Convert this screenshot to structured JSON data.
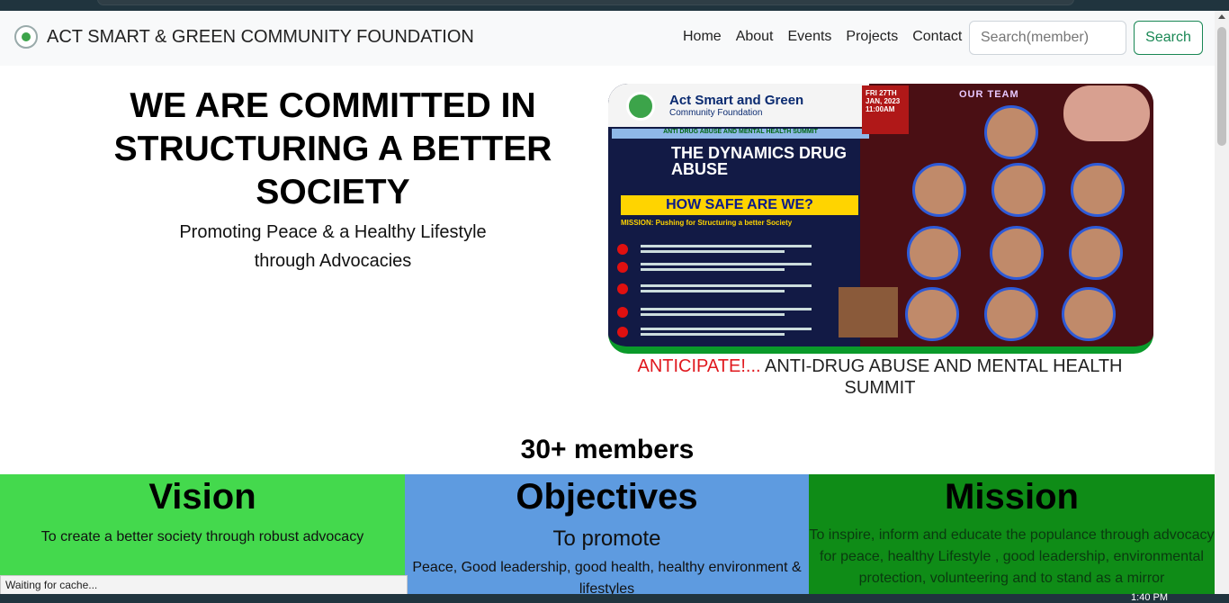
{
  "browser": {
    "status_text": "Waiting for cache...",
    "clock": "1:40 PM"
  },
  "nav": {
    "brand": "ACT SMART & GREEN COMMUNITY FOUNDATION",
    "links": [
      "Home",
      "About",
      "Events",
      "Projects",
      "Contact"
    ],
    "search_placeholder": "Search(member)",
    "search_button": "Search"
  },
  "hero": {
    "title": "WE ARE COMMITTED IN STRUCTURING A BETTER SOCIETY",
    "subtitle_line1": "Promoting Peace & a Healthy Lifestyle",
    "subtitle_line2": "through Advocacies"
  },
  "poster": {
    "org": "Act Smart and Green",
    "org_sub": "Community Foundation",
    "band": "ANTI DRUG ABUSE AND MENTAL HEALTH SUMMIT",
    "theme": "THE DYNAMICS DRUG ABUSE",
    "question": "HOW SAFE ARE WE?",
    "mission": "MISSION: Pushing for Structuring a better Society",
    "team_label": "OUR TEAM",
    "date": "FRI 27TH JAN, 2023 11:00AM"
  },
  "event": {
    "highlight": "ANTICIPATE!...",
    "text": " ANTI-DRUG ABUSE AND MENTAL HEALTH SUMMIT"
  },
  "stats": {
    "members": "30+ members"
  },
  "cards": {
    "vision_title": "Vision",
    "vision_text": "To create a better society through robust advocacy",
    "objectives_title": "Objectives",
    "objectives_lead": "To promote",
    "objectives_text": "Peace, Good leadership, good health, healthy environment & lifestyles",
    "mission_title": "Mission",
    "mission_text": "To inspire, inform and educate the populance through advocacy for peace, healthy Lifestyle , good leadership, environmental protection, volunteering and to stand as a mirror"
  },
  "colors": {
    "vision_bg": "#44d94d",
    "objectives_bg": "#5e9be0",
    "mission_bg": "#0f8c17",
    "search_accent": "#198754",
    "highlight": "#e0181e"
  }
}
